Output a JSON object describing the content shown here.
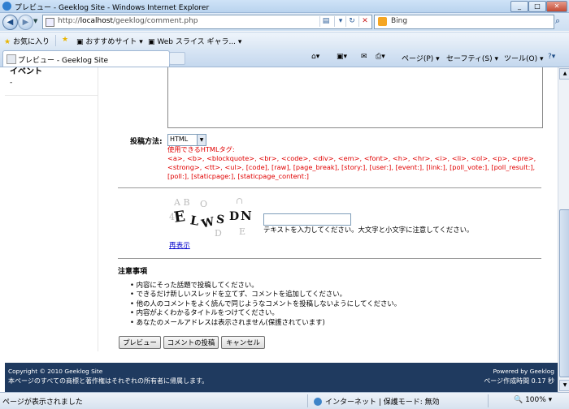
{
  "window": {
    "title": "プレビュー - Geeklog Site - Windows Internet Explorer"
  },
  "address": {
    "url_prefix": "http://",
    "url_host": "localhost",
    "url_path": "/geeklog/comment.php",
    "search_placeholder": "Bing"
  },
  "favorites_bar": {
    "favorites": "お気に入り",
    "suggested": "おすすめサイト ▾",
    "web_slice": "Web スライス ギャラ... ▾"
  },
  "tab": {
    "title": "プレビュー - Geeklog Site"
  },
  "commands": {
    "page": "ページ(P) ▾",
    "safety": "セーフティ(S) ▾",
    "tools": "ツール(O) ▾",
    "help": "?▾"
  },
  "sidebar": {
    "title": "イベント",
    "item": "-"
  },
  "form": {
    "post_method_label": "投稿方法:",
    "post_method_value": "HTML",
    "allowed_tags_title": "使用できるHTMLタグ:",
    "allowed_tags": "<a>, <b>, <blockquote>, <br>, <code>, <div>, <em>, <font>, <h>, <hr>, <i>, <li>, <ol>, <p>, <pre>, <strong>, <tt>, <ul>, [code], [raw], [page_break], [story:], [user:], [event:], [link:], [poll_vote:], [poll_result:], [poll:], [staticpage:], [staticpage_content:]",
    "captcha_hint": "テキストを入力してください。大文字と小文字に注意してください。",
    "refresh": "再表示",
    "notice_title": "注意事項",
    "notices": [
      "内容にそった話題で投稿してください。",
      "できるだけ新しいスレッドを立てず、コメントを追加してください。",
      "他の人のコメントをよく読んで同じようなコメントを投稿しないようにしてください。",
      "内容がよくわかるタイトルをつけてください。",
      "あなたのメールアドレスは表示されません(保護されています)"
    ],
    "buttons": {
      "preview": "プレビュー",
      "submit": "コメントの投稿",
      "cancel": "キャンセル"
    }
  },
  "captcha": {
    "chars": [
      "E",
      "L",
      "W",
      "S",
      "D",
      "N"
    ]
  },
  "footer": {
    "copyright": "Copyright © 2010 Geeklog Site",
    "rights": "本ページのすべての商標と著作権はそれぞれの所有者に帰属します。",
    "powered": "Powered by Geeklog",
    "gen_time": "ページ作成時間 0.17 秒"
  },
  "status": {
    "text": "ページが表示されました",
    "zone": "インターネット | 保護モード: 無効",
    "zoom": "100%"
  }
}
